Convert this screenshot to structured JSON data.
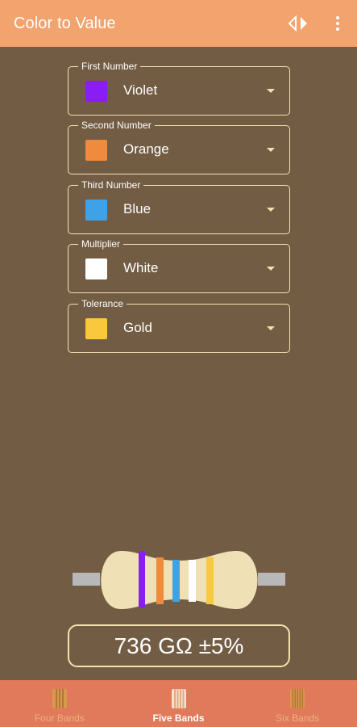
{
  "app_bar": {
    "title": "Color to Value",
    "swap_icon": "swap-horizontal-icon",
    "more_icon": "more-vertical-icon"
  },
  "selectors": [
    {
      "label": "First Number",
      "value": "Violet",
      "color": "#8a1cf5"
    },
    {
      "label": "Second Number",
      "value": "Orange",
      "color": "#f08a3c"
    },
    {
      "label": "Third Number",
      "value": "Blue",
      "color": "#3fa2e6"
    },
    {
      "label": "Multiplier",
      "value": "White",
      "color": "#ffffff"
    },
    {
      "label": "Tolerance",
      "value": "Gold",
      "color": "#f9c83c"
    }
  ],
  "result": {
    "text": "736 GΩ ±5%"
  },
  "bottom_nav": {
    "items": [
      {
        "label": "Four Bands",
        "active": false
      },
      {
        "label": "Five Bands",
        "active": true
      },
      {
        "label": "Six Bands",
        "active": false
      }
    ]
  },
  "colors": {
    "background": "#735c44",
    "app_bar": "#f2a36e",
    "bottom_nav": "#e07a5a",
    "border": "#f3e3b0",
    "resistor_body": "#efe0b6",
    "lead": "#b8b8b8"
  }
}
